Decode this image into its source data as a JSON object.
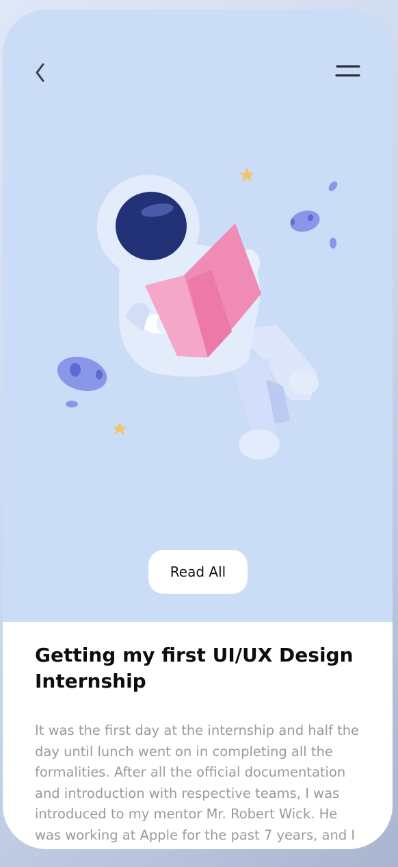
{
  "header": {
    "back_icon": "chevron-left-icon",
    "menu_icon": "menu-icon"
  },
  "illustration": {
    "subject": "astronaut-reading-icon",
    "colors": {
      "background": "#cbdcf6",
      "suit": "#e3ecfb",
      "visor": "#233177",
      "book": "#f08bb5",
      "planet": "#8a97e8",
      "star": "#f5c36a"
    }
  },
  "action": {
    "read_all_label": "Read All"
  },
  "article": {
    "title": "Getting my first UI/UX Design Internship",
    "body": "It was the first day at the internship and half the day until lunch went on in completing all the formalities. After all the official documentation and introduction with respective teams, I was introduced to my mentor Mr. Robert Wick. He was working at Apple for the past 7 years, and I deem it was"
  }
}
